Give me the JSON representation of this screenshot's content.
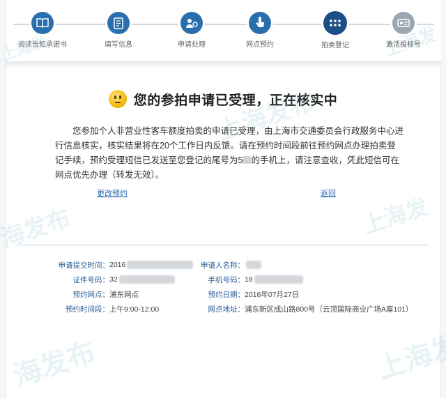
{
  "steps": [
    {
      "label": "阅读告知承诺书",
      "icon": "book-icon",
      "state": "done"
    },
    {
      "label": "填写信息",
      "icon": "form-icon",
      "state": "done"
    },
    {
      "label": "申请处理",
      "icon": "process-icon",
      "state": "done"
    },
    {
      "label": "网点预约",
      "icon": "hand-pointer-icon",
      "state": "done"
    },
    {
      "label": "拍卖登记",
      "icon": "dots-icon",
      "state": "active"
    },
    {
      "label": "激活投标号",
      "icon": "id-card-icon",
      "state": "pending"
    }
  ],
  "headline": "您的参拍申请已受理，正在核实中",
  "message": {
    "part1": "您参加个人非营业性客车额度拍卖的申请已受理，由上海市交通委员会行政服务中心进行信息核实，核实结果将在20个工作日内反馈。请在预约时间段前往预约网点办理拍卖登记手续，预约受理短信已发送至您登记的尾号为5",
    "part2": "的手机上，请注意查收，凭此短信可在网点优先办理（转发无效）。"
  },
  "links": {
    "change": "更改预约",
    "back": "返回"
  },
  "details": {
    "submit_time_label": "申请提交时间：",
    "submit_time_value": "2016",
    "id_label": "证件号码：",
    "id_value": "32",
    "branch_label": "预约网点：",
    "branch_value": "浦东网点",
    "slot_label": "预约时间段：",
    "slot_value": "上午9:00-12:00",
    "name_label": "申请人名称：",
    "name_value": "",
    "phone_label": "手机号码：",
    "phone_value": "18",
    "date_label": "预约日期：",
    "date_value": "2016年07月27日",
    "address_label": "网点地址：",
    "address_value": "浦东新区成山路800号（云顶国际商业广场A座101）"
  },
  "watermark": {
    "a": "上海发布",
    "b": "上海发",
    "c": "海发布",
    "d": "上海发布"
  },
  "colors": {
    "accent": "#2a6fad",
    "link": "#2a66b8",
    "label": "#2a5d97"
  }
}
